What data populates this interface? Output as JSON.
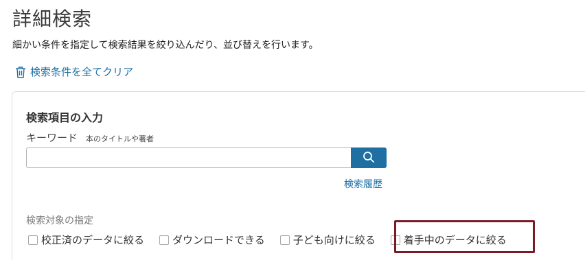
{
  "header": {
    "title": "詳細検索",
    "description": "細かい条件を指定して検索結果を絞り込んだり、並び替えを行います。",
    "clear_link": "検索条件を全てクリア",
    "clear_icon": "trash-icon"
  },
  "search_section": {
    "heading": "検索項目の入力",
    "keyword_label": "キーワード",
    "keyword_hint": "本のタイトルや著者",
    "keyword_value": "",
    "search_icon": "search-icon",
    "history_link": "検索履歴"
  },
  "target_section": {
    "label": "検索対象の指定",
    "options": [
      {
        "label": "校正済のデータに絞る",
        "checked": false
      },
      {
        "label": "ダウンロードできる",
        "checked": false
      },
      {
        "label": "子ども向けに絞る",
        "checked": false
      },
      {
        "label": "着手中のデータに絞る",
        "checked": false
      }
    ]
  },
  "colors": {
    "link": "#1d6fa5",
    "button": "#1f6fa3",
    "highlight": "#7a1b26"
  }
}
